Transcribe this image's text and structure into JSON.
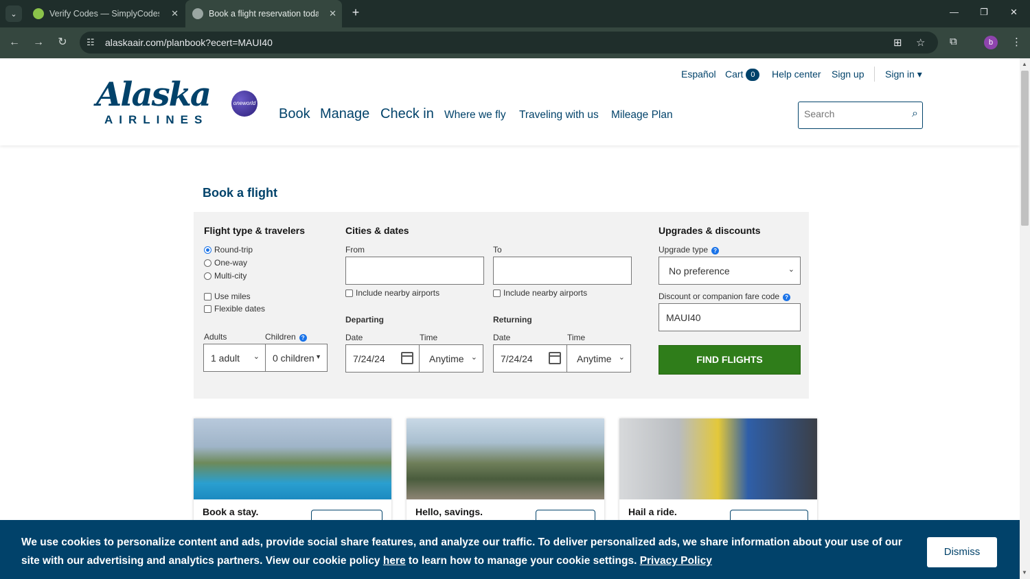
{
  "browser": {
    "tabs": [
      {
        "title": "Verify Codes — SimplyCodes",
        "favicon": "simplycodes-icon"
      },
      {
        "title": "Book a flight reservation today",
        "favicon": "alaska-icon"
      }
    ],
    "url": "alaskaair.com/planbook?ecert=MAUI40",
    "profile_initial": "b"
  },
  "header": {
    "logo_word": "Alaska",
    "logo_sub": "AIRLINES",
    "oneworld": "oneworld",
    "utility": {
      "espanol": "Español",
      "cart": "Cart",
      "cart_count": "0",
      "help": "Help center",
      "signup": "Sign up",
      "signin": "Sign in ▾"
    },
    "nav": {
      "book": "Book",
      "manage": "Manage",
      "checkin": "Check in",
      "where": "Where we fly",
      "traveling": "Traveling with us",
      "mileage": "Mileage Plan"
    },
    "search_placeholder": "Search"
  },
  "booking": {
    "title": "Book a flight",
    "flight_type": {
      "title": "Flight type & travelers",
      "trip_types": [
        "Round-trip",
        "One-way",
        "Multi-city"
      ],
      "selected": "Round-trip",
      "use_miles": "Use miles",
      "flexible_dates": "Flexible dates",
      "adults_label": "Adults",
      "children_label": "Children",
      "adults_value": "1 adult",
      "children_value": "0 children"
    },
    "cities": {
      "title": "Cities & dates",
      "from_label": "From",
      "to_label": "To",
      "nearby": "Include nearby airports",
      "departing_label": "Departing",
      "returning_label": "Returning",
      "date_label": "Date",
      "time_label": "Time",
      "depart_date": "7/24/24",
      "depart_time": "Anytime",
      "return_date": "7/24/24",
      "return_time": "Anytime"
    },
    "upgrades": {
      "title": "Upgrades & discounts",
      "upgrade_label": "Upgrade type",
      "upgrade_value": "No preference",
      "code_label": "Discount or companion fare code",
      "code_value": "MAUI40",
      "find_button": "FIND FLIGHTS"
    }
  },
  "cards": [
    {
      "title": "Book a stay."
    },
    {
      "title": "Hello, savings."
    },
    {
      "title": "Hail a ride."
    }
  ],
  "cookie": {
    "text_1": "We use cookies to personalize content and ads, provide social share features, and analyze our traffic. To deliver personalized ads, we share information about your use of our site with our advertising and analytics partners. View our cookie policy ",
    "link_here": "here",
    "text_2": " to learn how to manage your cookie settings. ",
    "link_privacy": "Privacy Policy",
    "dismiss": "Dismiss"
  },
  "colors": {
    "brand": "#01426a",
    "cta": "#2f7d1a",
    "chrome": "#1f2e2b"
  }
}
